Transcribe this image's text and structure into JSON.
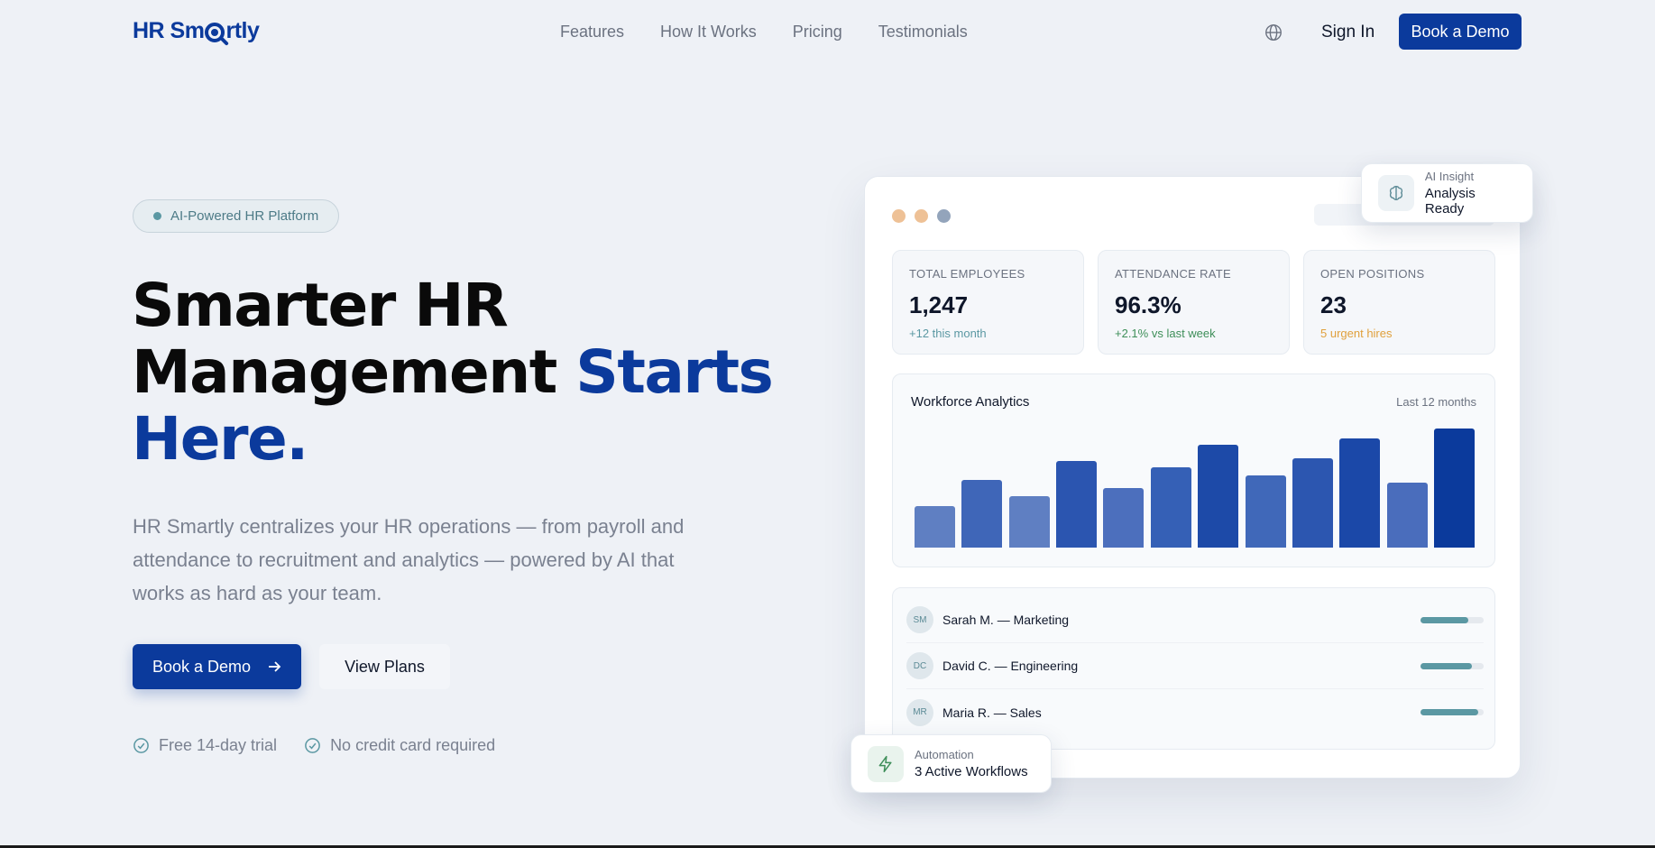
{
  "brand": {
    "logo_left": "HR Sm",
    "logo_right": "rtly",
    "accent": "#0b3a9c"
  },
  "nav": {
    "links": [
      "Features",
      "How It Works",
      "Pricing",
      "Testimonials"
    ],
    "globe_icon": "globe-icon",
    "signin_label": "Sign In",
    "demo_label": "Book a Demo"
  },
  "hero": {
    "badge": "AI-Powered HR Platform",
    "headline_line1": "Smarter HR",
    "headline_line2": "Management ",
    "headline_accent_a": "Starts",
    "headline_accent_b": "Here.",
    "description": "HR Smartly centralizes your HR operations — from payroll and attendance to recruitment and analytics — powered by AI that works as hard as your team.",
    "primary_cta": "Book a Demo",
    "secondary_cta": "View Plans",
    "perks": [
      "Free 14-day trial",
      "No credit card required"
    ]
  },
  "dashboard": {
    "stats": [
      {
        "label": "TOTAL EMPLOYEES",
        "value": "1,247",
        "sub": "+12 this month",
        "sub_color": "#5b98a3"
      },
      {
        "label": "ATTENDANCE RATE",
        "value": "96.3%",
        "sub": "+2.1% vs last week",
        "sub_color": "#3f8f5a"
      },
      {
        "label": "OPEN POSITIONS",
        "value": "23",
        "sub": "5 urgent hires",
        "sub_color": "#e0a03c"
      }
    ],
    "analytics_title": "Workforce Analytics",
    "analytics_range": "Last 12 months",
    "people": [
      {
        "initials": "SM",
        "name": "Sarah M. — Marketing",
        "progress": 0.75
      },
      {
        "initials": "DC",
        "name": "David C. — Engineering",
        "progress": 0.82
      },
      {
        "initials": "MR",
        "name": "Maria R. — Sales",
        "progress": 0.92
      }
    ]
  },
  "chart_data": {
    "type": "bar",
    "title": "Workforce Analytics",
    "categories": [],
    "values": [
      36,
      58,
      44,
      74,
      51,
      69,
      88,
      62,
      77,
      94,
      56,
      102
    ],
    "ylim": [
      0,
      110
    ],
    "colors": [
      "#5f7fc2",
      "#3f66b8",
      "#5f7fc2",
      "#2b55b0",
      "#4c6fbd",
      "#3560b6",
      "#1d4aa8",
      "#4068b9",
      "#2c56b0",
      "#1b48a8",
      "#4a6dbc",
      "#0b3a9c"
    ]
  },
  "floats": {
    "ai_label": "AI Insight",
    "ai_value": "Analysis Ready",
    "auto_label": "Automation",
    "auto_value": "3 Active Workflows"
  }
}
